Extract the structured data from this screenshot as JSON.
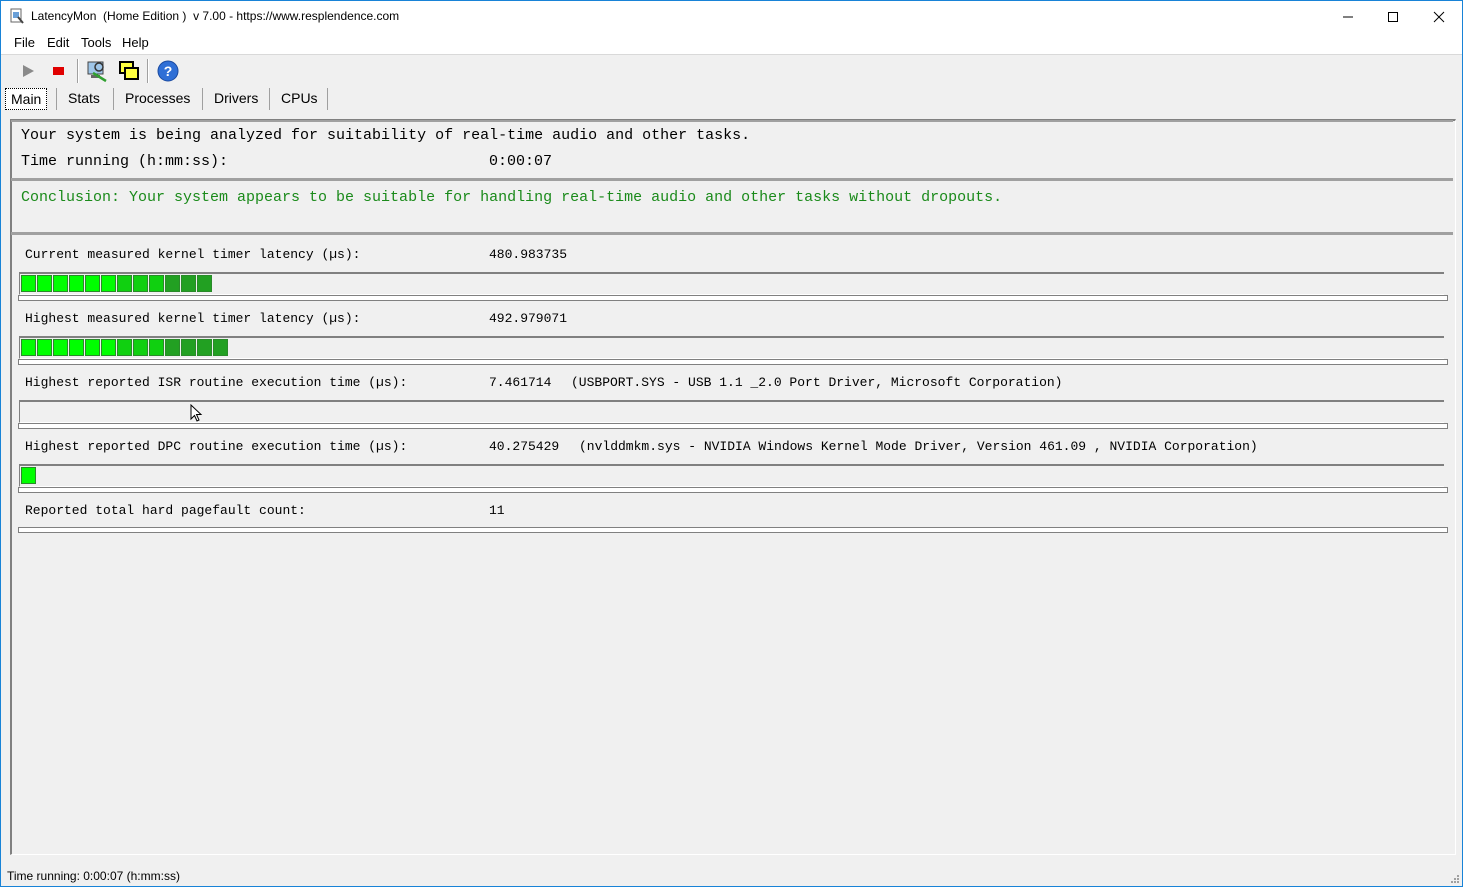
{
  "window": {
    "title": "LatencyMon  (Home Edition )  v 7.00 - https://www.resplendence.com"
  },
  "menu": [
    "File",
    "Edit",
    "Tools",
    "Help"
  ],
  "tabs": [
    "Main",
    "Stats",
    "Processes",
    "Drivers",
    "CPUs"
  ],
  "analysis": {
    "status": "Your system is being analyzed for suitability of real-time audio and other tasks.",
    "time_label": "Time running (h:mm:ss):",
    "time_value": "0:00:07",
    "conclusion": "Conclusion: Your system appears to be suitable for handling real-time audio and other tasks without dropouts."
  },
  "metrics": [
    {
      "label": "Current measured kernel timer latency (µs):",
      "value": "480.983735",
      "detail": "",
      "bar_segments": 12
    },
    {
      "label": "Highest measured kernel timer latency (µs):",
      "value": "492.979071",
      "detail": "",
      "bar_segments": 13
    },
    {
      "label": "Highest reported ISR routine execution time (µs):",
      "value": "7.461714",
      "detail": "(USBPORT.SYS - USB 1.1 _2.0 Port Driver, Microsoft Corporation)",
      "bar_segments": 0
    },
    {
      "label": "Highest reported DPC routine execution time (µs):",
      "value": "40.275429",
      "detail": "(nvlddmkm.sys - NVIDIA Windows Kernel Mode Driver, Version 461.09 , NVIDIA Corporation)",
      "bar_segments": 1
    },
    {
      "label": "Reported total hard pagefault count:",
      "value": "11",
      "detail": ""
    }
  ],
  "statusbar": {
    "text": "Time running: 0:00:07  (h:mm:ss)"
  },
  "colors": {
    "conclusion_text": "#1a8a1a",
    "bar_bright": "#00ff00",
    "bar_dark": "#22a022",
    "accent_border": "#1883d7"
  },
  "icons": {
    "play": "play-icon",
    "stop": "stop-icon",
    "search": "search-icon",
    "windows": "windows-icon",
    "help": "help-icon"
  }
}
